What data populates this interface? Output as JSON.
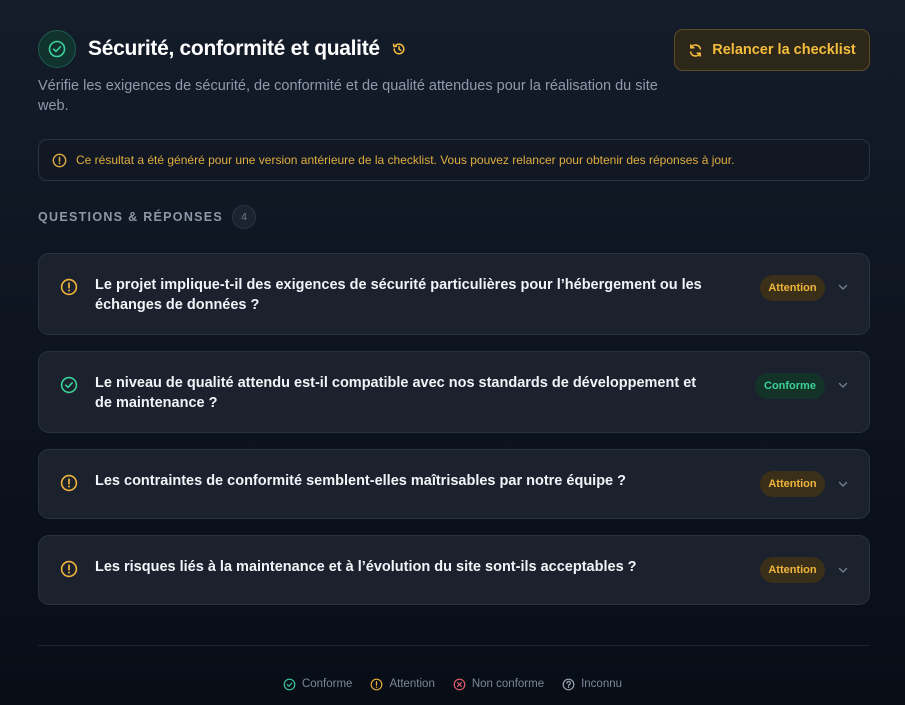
{
  "header": {
    "title": "Sécurité, conformité et qualité",
    "subtitle": "Vérifie les exigences de sécurité, de conformité et de qualité attendues pour la réalisation du site web.",
    "rerun_label": "Relancer la checklist"
  },
  "notice": {
    "text": "Ce résultat a été généré pour une version antérieure de la checklist. Vous pouvez relancer pour obtenir des réponses à jour."
  },
  "section": {
    "title": "QUESTIONS & RÉPONSES",
    "count": "4"
  },
  "questions": [
    {
      "text": "Le projet implique-t-il des exigences de sécurité particulières pour l’hébergement ou les échanges de données ?",
      "status": "Attention",
      "icon": "warning-circle-icon"
    },
    {
      "text": "Le niveau de qualité attendu est-il compatible avec nos standards de développement et de maintenance ?",
      "status": "Conforme",
      "icon": "check-circle-icon"
    },
    {
      "text": "Les contraintes de conformité semblent-elles maîtrisables par notre équipe ?",
      "status": "Attention",
      "icon": "warning-circle-icon"
    },
    {
      "text": "Les risques liés à la maintenance et à l’évolution du site sont-ils acceptables ?",
      "status": "Attention",
      "icon": "warning-circle-icon"
    }
  ],
  "legend": [
    {
      "label": "Conforme",
      "icon": "check-circle-icon",
      "color": "#3bc79a"
    },
    {
      "label": "Attention",
      "icon": "warning-circle-icon",
      "color": "#e8ad3a"
    },
    {
      "label": "Non conforme",
      "icon": "x-circle-icon",
      "color": "#e05c6e"
    },
    {
      "label": "Inconnu",
      "icon": "question-circle-icon",
      "color": "#9aa3b2"
    }
  ],
  "colors": {
    "accent": "#f5bd3d",
    "success": "#3bd39a",
    "warning": "#f0b53c",
    "danger": "#e05c6e"
  }
}
